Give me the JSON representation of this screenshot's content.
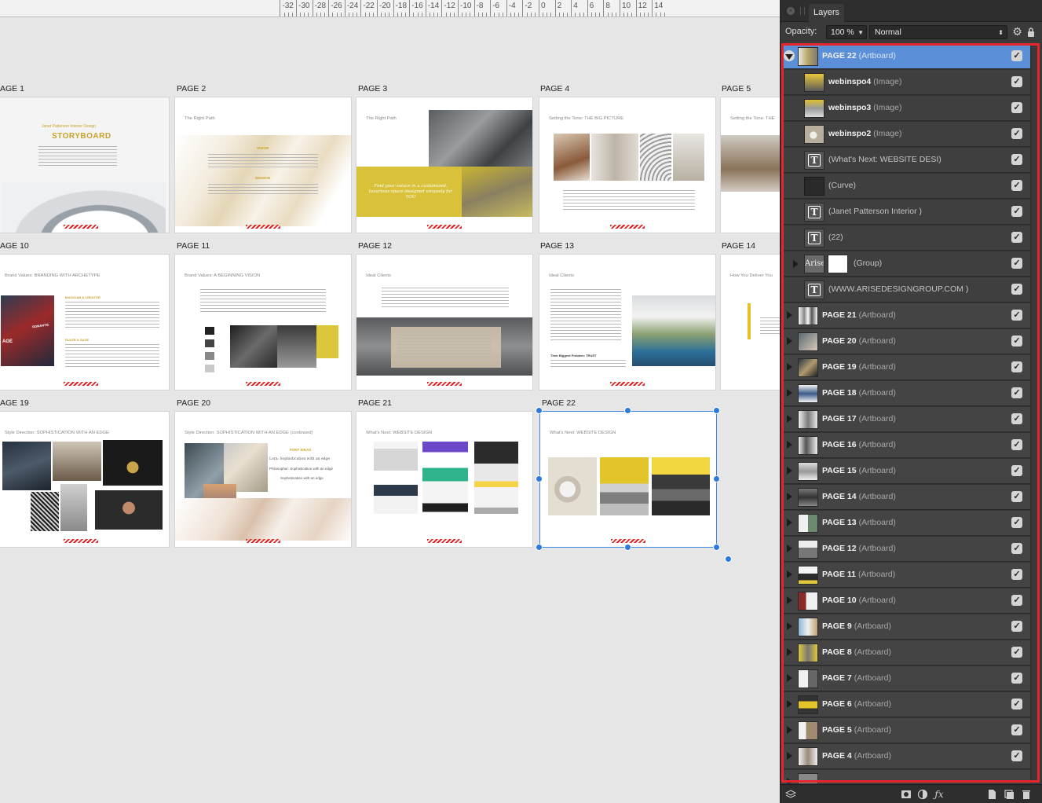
{
  "ruler": {
    "labels": [
      "-32",
      "-30",
      "-28",
      "-26",
      "-24",
      "-22",
      "-20",
      "-18",
      "-16",
      "-14",
      "-12",
      "-10",
      "-8",
      "-6",
      "-4",
      "-2",
      "0",
      "2",
      "4",
      "6",
      "8",
      "10",
      "12",
      "14"
    ]
  },
  "canvas": {
    "page_labels": [
      "AGE 1",
      "PAGE 2",
      "PAGE 3",
      "PAGE 4",
      "PAGE 5",
      "AGE 10",
      "PAGE 11",
      "PAGE 12",
      "PAGE 13",
      "PAGE 14",
      "AGE 19",
      "PAGE 20",
      "PAGE 21",
      "PAGE 22"
    ],
    "artboard_headings": {
      "p1_brand": "Janet Patterson Interior Design",
      "p1_title": "STORYBOARD",
      "p2": "The Right Path",
      "p2_vision": "VISION",
      "p2_mission": "MISSION",
      "p3": "The Right Path",
      "p3_quote": "Find your solace in a customized, luxurious space designed uniquely for YOU",
      "p4": "Setting the Tone: THE BIG PICTURE",
      "p5": "Setting the Tone: THE",
      "p10": "Brand Values: BRANDING WITH ARCHETYPE",
      "p10_sub1": "MAGICIAN & CREATOR",
      "p10_sub2": "RULER & SAGE",
      "p10_img": "ROMANTIC",
      "p10_img2": "AGE",
      "p11": "Brand Values: A BEGINNING VISION",
      "p12": "Ideal Clients",
      "p13": "Ideal Clients",
      "p13_sub": "Their Biggest Problem: TRUST",
      "p14": "How You Deliver You",
      "p19": "Style Direction: SOPHISTICATION WITH AN EDGE",
      "p20": "Style Direction: SOPHISTICATION WITH AN EDGE (continued)",
      "p20_sub": "FONT IDEAS",
      "p20_f1": "Lora: Sophistication with an edge",
      "p20_f2": "Philosopher: Sophistication with an edge",
      "p20_f3": "Sophistication with an edge",
      "p21": "What's Next: WEBSITE DESIGN",
      "p22": "What's Next: WEBSITE DESIGN"
    }
  },
  "panel": {
    "tab": "Layers",
    "opacity_label": "Opacity:",
    "opacity_value": "100 %",
    "blend_mode": "Normal",
    "layers": [
      {
        "name": "PAGE 22",
        "type": "(Artboard)",
        "kind": "artboard",
        "selected": true,
        "open": true
      },
      {
        "name": "webinspo4",
        "type": "(Image)",
        "kind": "image"
      },
      {
        "name": "webinspo3",
        "type": "(Image)",
        "kind": "image"
      },
      {
        "name": "webinspo2",
        "type": "(Image)",
        "kind": "image"
      },
      {
        "name": "(What's Next: WEBSITE DESI)",
        "type": "",
        "kind": "text"
      },
      {
        "name": "(Curve)",
        "type": "",
        "kind": "curve"
      },
      {
        "name": "(Janet Patterson Interior )",
        "type": "",
        "kind": "text"
      },
      {
        "name": "(22)",
        "type": "",
        "kind": "text"
      },
      {
        "name": "(Group)",
        "type": "",
        "kind": "group"
      },
      {
        "name": "(WWW.ARISEDESIGNGROUP.COM )",
        "type": "",
        "kind": "text"
      },
      {
        "name": "PAGE 21",
        "type": "(Artboard)",
        "kind": "artboard"
      },
      {
        "name": "PAGE 20",
        "type": "(Artboard)",
        "kind": "artboard"
      },
      {
        "name": "PAGE 19",
        "type": "(Artboard)",
        "kind": "artboard"
      },
      {
        "name": "PAGE 18",
        "type": "(Artboard)",
        "kind": "artboard"
      },
      {
        "name": "PAGE 17",
        "type": "(Artboard)",
        "kind": "artboard"
      },
      {
        "name": "PAGE 16",
        "type": "(Artboard)",
        "kind": "artboard"
      },
      {
        "name": "PAGE 15",
        "type": "(Artboard)",
        "kind": "artboard"
      },
      {
        "name": "PAGE 14",
        "type": "(Artboard)",
        "kind": "artboard"
      },
      {
        "name": "PAGE 13",
        "type": "(Artboard)",
        "kind": "artboard"
      },
      {
        "name": "PAGE 12",
        "type": "(Artboard)",
        "kind": "artboard"
      },
      {
        "name": "PAGE 11",
        "type": "(Artboard)",
        "kind": "artboard"
      },
      {
        "name": "PAGE 10",
        "type": "(Artboard)",
        "kind": "artboard"
      },
      {
        "name": "PAGE 9",
        "type": "(Artboard)",
        "kind": "artboard"
      },
      {
        "name": "PAGE 8",
        "type": "(Artboard)",
        "kind": "artboard"
      },
      {
        "name": "PAGE 7",
        "type": "(Artboard)",
        "kind": "artboard"
      },
      {
        "name": "PAGE 6",
        "type": "(Artboard)",
        "kind": "artboard"
      },
      {
        "name": "PAGE 5",
        "type": "(Artboard)",
        "kind": "artboard"
      },
      {
        "name": "PAGE 4",
        "type": "(Artboard)",
        "kind": "artboard"
      }
    ],
    "group_thumb_text": "Arise",
    "colors": {
      "selection": "#5b8fd8",
      "highlight_outline": "#e5262d",
      "accent_yellow": "#e3c22a"
    }
  }
}
